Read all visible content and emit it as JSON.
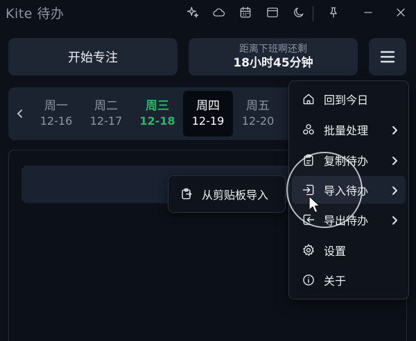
{
  "app": {
    "title": "Kite 待办"
  },
  "titlebar_icons": [
    "sparkle-icon",
    "cloud-icon",
    "calendar-icon",
    "window-icon",
    "moon-icon",
    "pin-icon",
    "minimize-icon",
    "close-icon"
  ],
  "toolbar": {
    "focus_label": "开始专注",
    "countdown_label": "距离下班啊还剩",
    "countdown_value": "18小时45分钟"
  },
  "week": {
    "days": [
      {
        "name": "周一",
        "date": "12-16"
      },
      {
        "name": "周二",
        "date": "12-17"
      },
      {
        "name": "周三",
        "date": "12-18"
      },
      {
        "name": "周四",
        "date": "12-19"
      },
      {
        "name": "周五",
        "date": "12-20"
      }
    ],
    "today": "周三",
    "selected": "周四"
  },
  "menu": {
    "items": [
      {
        "label": "回到今日",
        "icon": "home-icon"
      },
      {
        "label": "批量处理",
        "icon": "stack-icon"
      },
      {
        "label": "复制待办",
        "icon": "copy-icon"
      },
      {
        "label": "导入待办",
        "icon": "import-icon"
      },
      {
        "label": "导出待办",
        "icon": "export-icon"
      },
      {
        "label": "设置",
        "icon": "gear-icon"
      },
      {
        "label": "关于",
        "icon": "info-icon"
      }
    ]
  },
  "submenu": {
    "items": [
      {
        "label": "从剪贴板导入",
        "icon": "clipboard-icon"
      }
    ]
  },
  "colors": {
    "background": "#0c1019",
    "panel": "#1e2533",
    "today_accent": "#2fb36a",
    "selected_day_bg": "#070a10"
  }
}
